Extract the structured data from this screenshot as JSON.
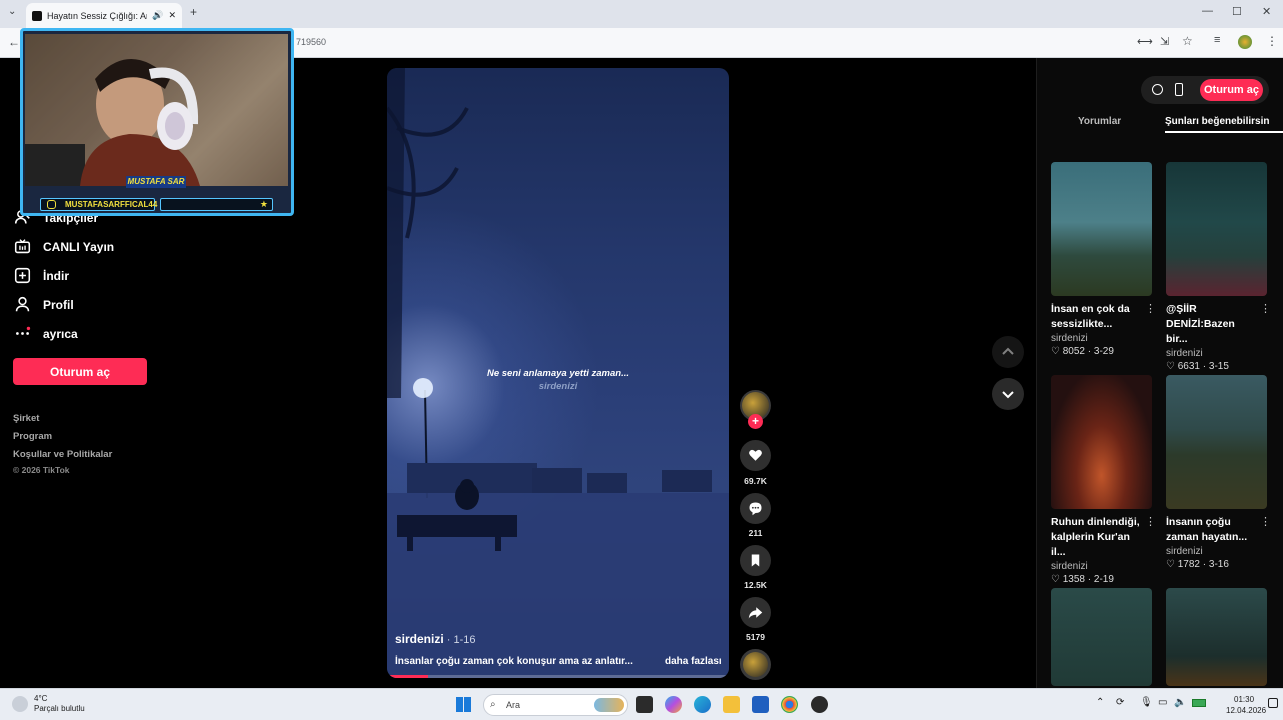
{
  "browser": {
    "tab_title": "Hayatın Sessiz Çığlığı: Anlatı",
    "url_fragment": "719560"
  },
  "cam": {
    "name": "MUSTAFA SAR",
    "handle": "MUSTAFASARFFICAL44"
  },
  "sidebar": {
    "items": [
      {
        "label": "Takipçiler",
        "icon": "followers-icon"
      },
      {
        "label": "CANLI Yayın",
        "icon": "live-icon"
      },
      {
        "label": "İndir",
        "icon": "download-icon"
      },
      {
        "label": "Profil",
        "icon": "profile-icon"
      },
      {
        "label": "ayrıca",
        "icon": "more-icon"
      }
    ],
    "login_label": "Oturum aç",
    "footer": {
      "company": "Şirket",
      "program": "Program",
      "terms": "Koşullar ve Politikalar",
      "copyright": "© 2026 TikTok"
    }
  },
  "video": {
    "caption": "Ne seni anlamaya yetti zaman...",
    "watermark": "sirdenizi",
    "author": "sirdenizi",
    "date": " · 1-16",
    "description": "İnsanlar çoğu zaman çok konuşur ama az anlatır...",
    "more_label": "daha fazlası",
    "progress": 0.12
  },
  "actions": {
    "likes": "69.7K",
    "comments": "211",
    "saves": "12.5K",
    "shares": "5179"
  },
  "right_panel": {
    "login_label": "Oturum aç",
    "tabs": [
      "Yorumlar",
      "Şunları beğenebilirsin"
    ],
    "recommendations": [
      {
        "title": "İnsan en çok da sessizlikte...",
        "author": "sirdenizi",
        "likes": "8052",
        "date": "3-29"
      },
      {
        "title": "@ŞİİR DENİZİ:Bazen bir...",
        "author": "sirdenizi",
        "likes": "6631",
        "date": "3-15"
      },
      {
        "title": "Ruhun dinlendiği, kalplerin Kur'an il...",
        "author": "sirdenizi",
        "likes": "1358",
        "date": "2-19"
      },
      {
        "title": "İnsanın çoğu zaman hayatın...",
        "author": "sirdenizi",
        "likes": "1782",
        "date": "3-16"
      }
    ]
  },
  "taskbar": {
    "temperature": "4°C",
    "weather": "Parçalı bulutlu",
    "search_placeholder": "Ara",
    "time": "01:30",
    "date": "12.04.2026"
  },
  "colors": {
    "brand": "#fe2c55",
    "background": "#000000",
    "cam_border": "#3fb6f2"
  }
}
